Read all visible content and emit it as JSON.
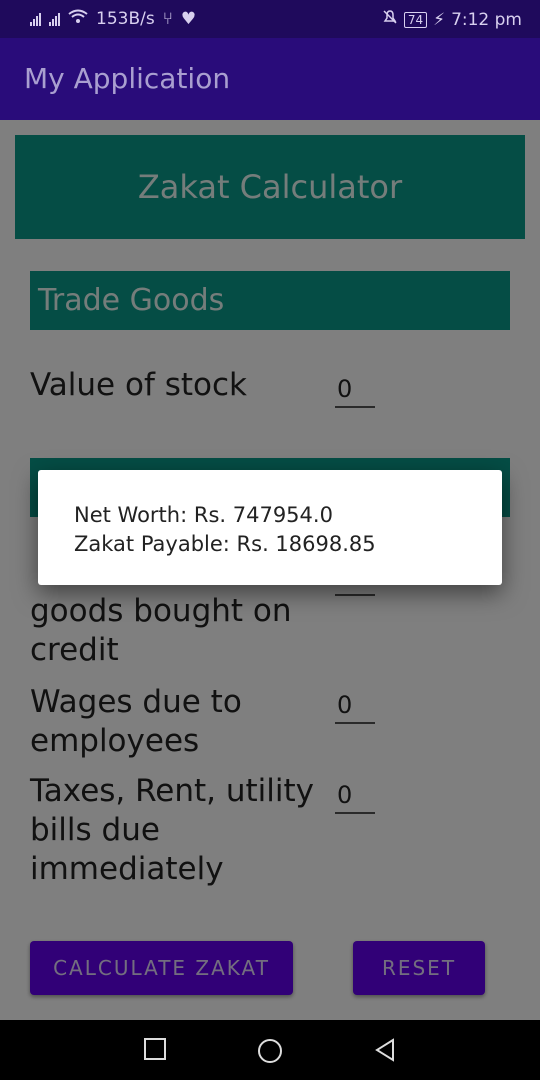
{
  "status_bar": {
    "net_speed": "153B/s",
    "battery": "74",
    "time": "7:12 pm"
  },
  "app_bar": {
    "title": "My Application"
  },
  "main": {
    "banner": "Zakat Calculator",
    "section_trade": "Trade Goods",
    "value_of_stock_label": "Value of stock",
    "value_of_stock_value": "0",
    "section_hidden_value": "",
    "borrowed_label_partial": "goods bought on credit",
    "borrowed_value": "",
    "wages_label": "Wages due to employees",
    "wages_value": "0",
    "taxes_label": "Taxes, Rent, utility bills due immediately",
    "taxes_value": "0",
    "calculate_button": "CALCULATE ZAKAT",
    "reset_button": "RESET"
  },
  "dialog": {
    "net_worth": "Net Worth: Rs. 747954.0",
    "zakat_payable": "Zakat Payable: Rs. 18698.85"
  },
  "colors": {
    "status_bar": "#1f0a5c",
    "app_bar": "#290c7a",
    "teal": "#0b9b8a",
    "button": "#6200ee"
  }
}
